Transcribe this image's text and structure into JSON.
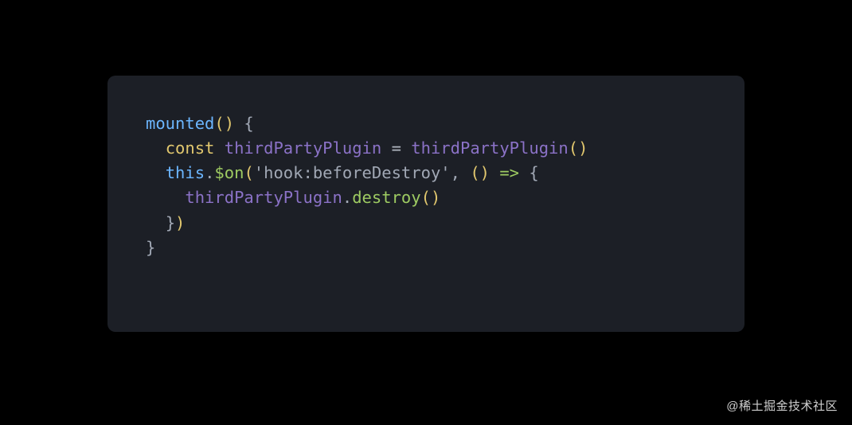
{
  "code": {
    "line1": {
      "fn": "mounted",
      "paren": "()",
      "brace": " {"
    },
    "line2": {
      "indent": "  ",
      "kw": "const",
      "sp1": " ",
      "var": "thirdPartyPlugin",
      "sp2": " ",
      "op": "=",
      "sp3": " ",
      "call": "thirdPartyPlugin",
      "paren": "()"
    },
    "line3": {
      "indent": "  ",
      "this": "this",
      "dot": ".",
      "method": "$on",
      "lparen": "(",
      "str": "'hook:beforeDestroy'",
      "comma": ", ",
      "argp": "()",
      "sp": " ",
      "arrow": "=>",
      "sp2": " ",
      "brace": "{"
    },
    "line4": {
      "indent": "    ",
      "var": "thirdPartyPlugin",
      "dot": ".",
      "method": "destroy",
      "paren": "()"
    },
    "line5": {
      "indent": "  ",
      "brace": "}",
      "rparen": ")"
    },
    "line6": {
      "brace": "}"
    }
  },
  "watermark": "@稀土掘金技术社区"
}
